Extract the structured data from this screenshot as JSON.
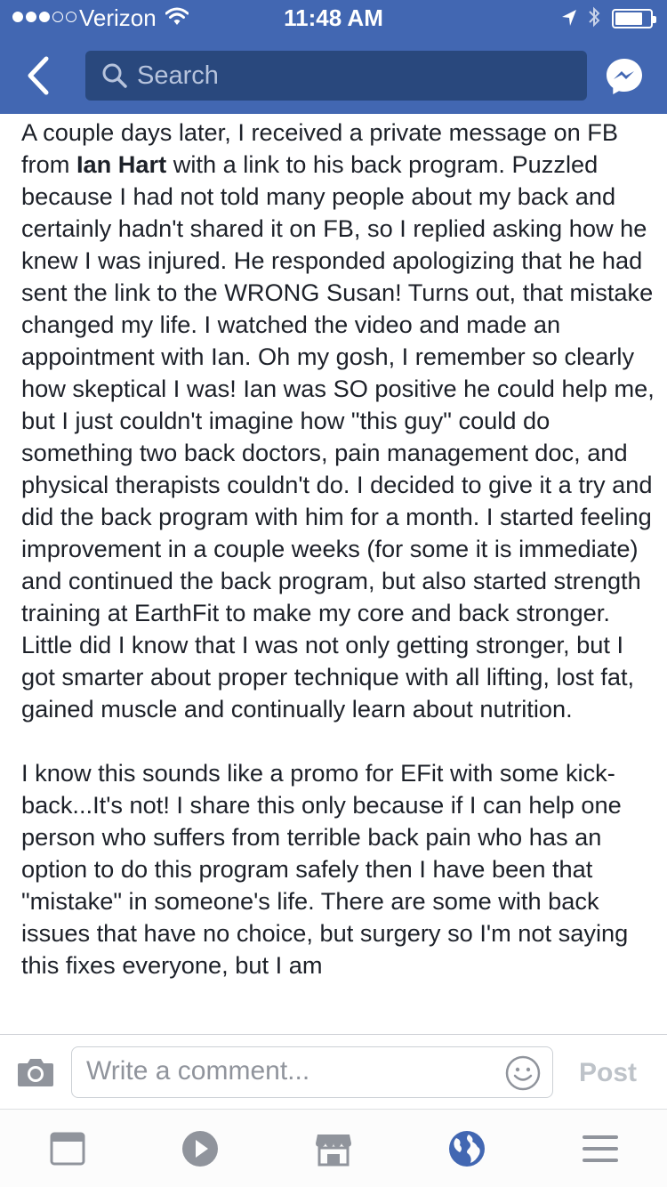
{
  "status_bar": {
    "carrier": "Verizon",
    "time": "11:48 AM",
    "signal_bars_filled": 3,
    "signal_bars_total": 5,
    "battery_level": 0.7
  },
  "nav": {
    "search_placeholder": "Search",
    "back_icon": "chevron-left-icon",
    "messenger_icon": "messenger-icon",
    "background_color": "#4267b2"
  },
  "post": {
    "para1_before": "A couple days later, I received a private message on FB from ",
    "para1_name": "Ian Hart",
    "para1_after": " with a link to his back program.  Puzzled because I had not told many people about my back and certainly hadn't shared it on FB, so I replied asking how he knew I was injured.  He responded apologizing that he had sent the link to the WRONG Susan!  Turns out, that mistake changed my life.  I watched the video and made an appointment with Ian.  Oh my gosh, I remember so clearly how skeptical I was!  Ian was SO positive he could help me, but I just couldn't imagine how \"this guy\" could do something two back doctors, pain management doc, and physical therapists couldn't do.  I decided to give it a try and did the back program with him for a month.  I started feeling improvement in a couple weeks (for some it is immediate) and continued the back program, but also started strength training at EarthFit to make my core and back stronger.  Little did I know that I was not only getting stronger, but I got smarter about proper technique with all lifting, lost fat, gained muscle and continually learn about nutrition.",
    "para2": "I know this sounds like a promo for EFit with some kick-back...It's not!  I share this only because if I can help one person who suffers from terrible back pain who has an option to do this program safely then I have been that \"mistake\" in someone's life.  There are some with back issues that have no choice, but surgery so I'm not saying this fixes everyone, but I am"
  },
  "comment_bar": {
    "placeholder": "Write a comment...",
    "post_label": "Post",
    "camera_icon": "camera-icon",
    "emoji_icon": "smiley-icon"
  },
  "tab_bar": {
    "tabs": [
      {
        "icon": "news-feed-icon",
        "active": false
      },
      {
        "icon": "video-play-icon",
        "active": false
      },
      {
        "icon": "marketplace-icon",
        "active": false
      },
      {
        "icon": "globe-notifications-icon",
        "active": true
      },
      {
        "icon": "menu-icon",
        "active": false
      }
    ],
    "active_color": "#4267b2",
    "inactive_color": "#90949c"
  }
}
